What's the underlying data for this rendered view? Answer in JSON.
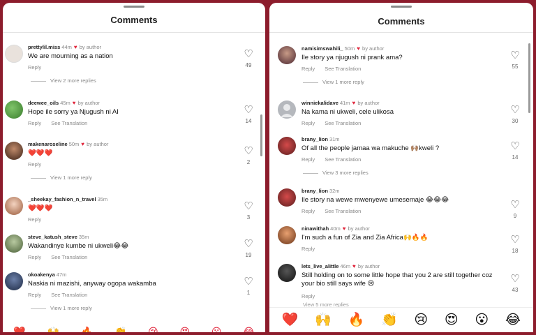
{
  "left": {
    "title": "Comments",
    "comments": [
      {
        "user": "prettylil.miss",
        "time": "44m",
        "by_author": "by author",
        "text": "We are mourning as a nation",
        "reply": "Reply",
        "translation": "",
        "likes": "49",
        "more": "View 2 more replies"
      },
      {
        "user": "deewee_oils",
        "time": "45m",
        "by_author": "by author",
        "text": "Hope ile sorry ya Njugush ni AI",
        "reply": "Reply",
        "translation": "See Translation",
        "likes": "14",
        "more": ""
      },
      {
        "user": "makenaroseline",
        "time": "50m",
        "by_author": "by author",
        "text": "❤️❤️❤️",
        "reply": "Reply",
        "translation": "",
        "likes": "2",
        "more": "View 1 more reply"
      },
      {
        "user": "_sheekay_fashion_n_travel",
        "time": "35m",
        "by_author": "",
        "text": "❤️❤️❤️",
        "reply": "Reply",
        "translation": "",
        "likes": "3",
        "more": ""
      },
      {
        "user": "steve_katush_steve",
        "time": "35m",
        "by_author": "",
        "text": "Wakandinye kumbe ni ukweli😂😂",
        "reply": "Reply",
        "translation": "See Translation",
        "likes": "19",
        "more": ""
      },
      {
        "user": "okoakenya",
        "time": "47m",
        "by_author": "",
        "text": "Naskia ni mazishi, anyway ogopa wakamba",
        "reply": "Reply",
        "translation": "See Translation",
        "likes": "1",
        "more": "View 1 more reply"
      }
    ],
    "emojis": [
      "❤️",
      "🙌",
      "🔥",
      "👏",
      "😢",
      "😍",
      "😮",
      "😂"
    ]
  },
  "right": {
    "title": "Comments",
    "comments": [
      {
        "user": "namisimswahili_",
        "time": "50m",
        "by_author": "by author",
        "text": "Ile story ya njugush ni prank ama?",
        "reply": "Reply",
        "translation": "See Translation",
        "likes": "55",
        "more": "View 1 more reply"
      },
      {
        "user": "winniekalidave",
        "time": "41m",
        "by_author": "by author",
        "text": "Na kama ni ukweli, cele ulikosa",
        "reply": "Reply",
        "translation": "See Translation",
        "likes": "30",
        "more": ""
      },
      {
        "user": "brany_lion",
        "time": "31m",
        "by_author": "",
        "text": "Of all the people jamaa wa makuche 🙌🏽kweli ?",
        "reply": "Reply",
        "translation": "See Translation",
        "likes": "14",
        "more": "View 3 more replies"
      },
      {
        "user": "brany_lion",
        "time": "32m",
        "by_author": "",
        "text": "Ile story na wewe mwenyewe umesemaje 😂😂😂",
        "reply": "Reply",
        "translation": "See Translation",
        "likes": "9",
        "more": ""
      },
      {
        "user": "ninawithah",
        "time": "40m",
        "by_author": "by author",
        "text": "I'm such a fun of Zia and Zia Africa🙌🔥🔥",
        "reply": "Reply",
        "translation": "",
        "likes": "18",
        "more": ""
      },
      {
        "user": "lets_live_alittle",
        "time": "46m",
        "by_author": "by author",
        "text": "Still holding on to some little hope that you 2 are still together coz your bio still says wife 😢",
        "reply": "Reply",
        "translation": "",
        "likes": "43",
        "more": ""
      }
    ],
    "faint_more": "View 5 more replies",
    "emojis": [
      "❤️",
      "🙌",
      "🔥",
      "👏",
      "😢",
      "😍",
      "😮",
      "😂"
    ]
  },
  "colors": {
    "frame": "#8c1c2c",
    "author_heart": "#e0243a",
    "muted_text": "#888888"
  },
  "icons": {
    "like": "heart-outline-icon",
    "author_like": "heart-filled-icon"
  }
}
